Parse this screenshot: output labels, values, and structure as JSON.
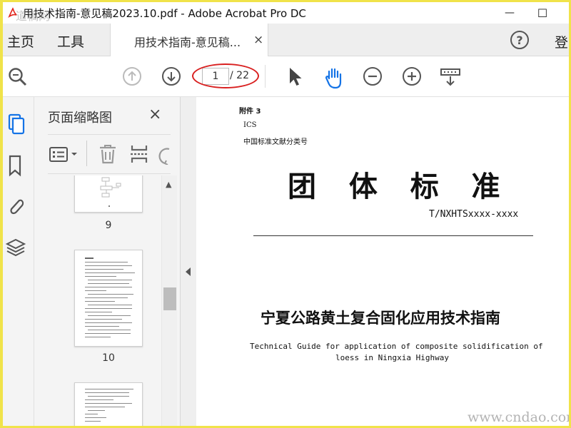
{
  "window": {
    "title": "用技术指南-意见稿2023.10.pdf - Adobe Acrobat Pro DC",
    "minimize_label": "—",
    "maximize_label": "☐"
  },
  "tabbar": {
    "home_label": "主页",
    "tools_label": "工具",
    "doc_tab_label": "用技术指南-意见稿...",
    "doc_tab_close": "×",
    "help_label": "?",
    "login_label": "登"
  },
  "toolbar": {
    "page_current": "1",
    "page_total": "/ 22",
    "annotation_color": "#d92020"
  },
  "panel": {
    "title": "页面缩略图",
    "close": "×",
    "thumbnails": [
      {
        "number": "9"
      },
      {
        "number": "10"
      }
    ]
  },
  "document": {
    "annex": "附件 3",
    "ics": "ICS",
    "classification": "中国标准文献分类号",
    "heading": "团  体  标  准",
    "standard_code": "T/NXHTSxxxx-xxxx",
    "title_cn": "宁夏公路黄土复合固化应用技术指南",
    "title_en_line1": "Technical Guide for application of composite solidification of",
    "title_en_line2": "loess in Ningxia Highway"
  },
  "watermarks": {
    "top_left": "道稿网",
    "bottom_right": "www.cndao.com"
  },
  "colors": {
    "accent_blue": "#1473e6",
    "icon_gray": "#555555",
    "pdf_red": "#e2231a",
    "border_yellow": "#f0e34a"
  }
}
